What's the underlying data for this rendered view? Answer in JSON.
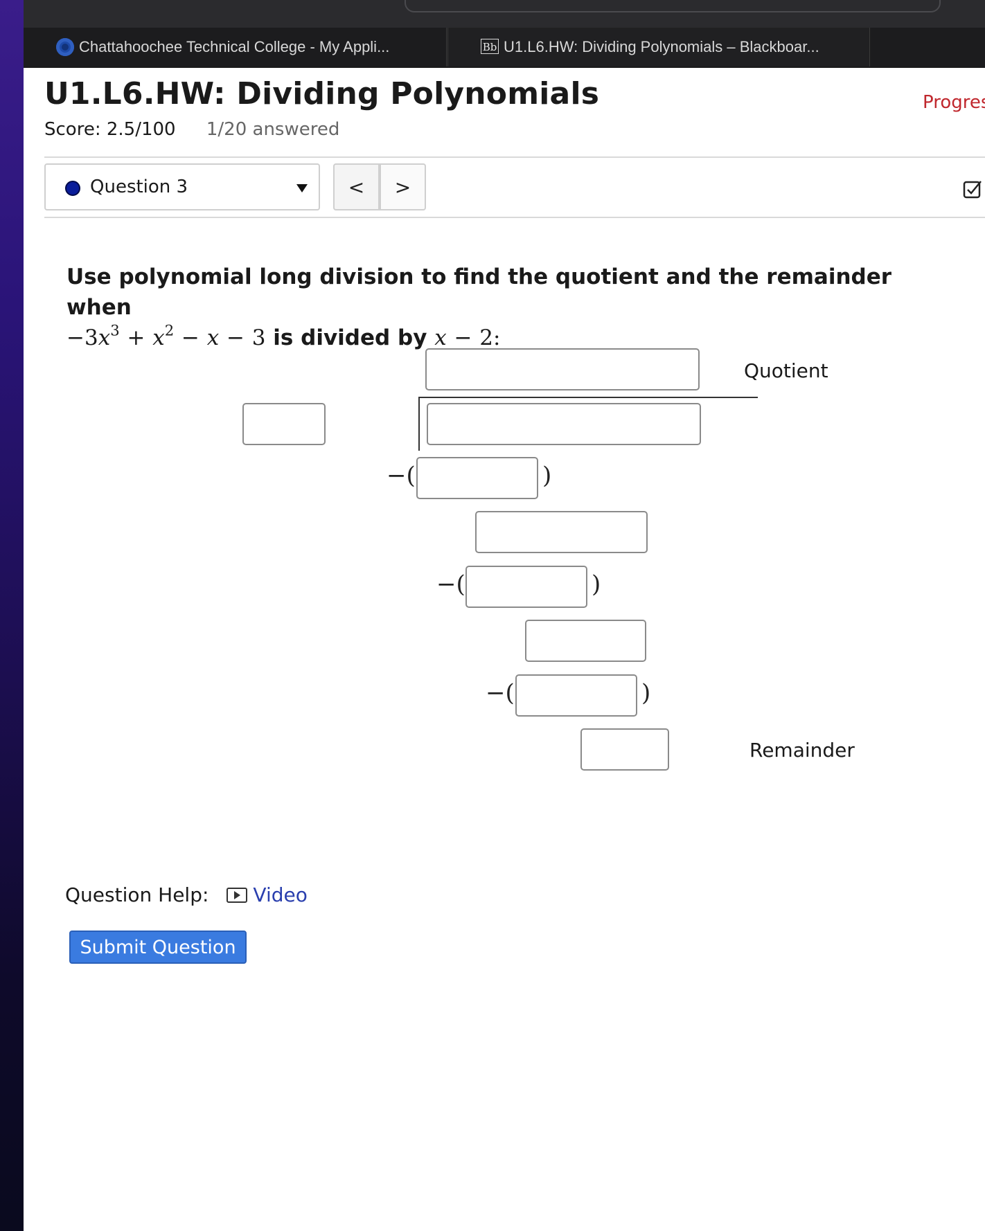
{
  "browser": {
    "tabs": [
      {
        "label": "Chattahoochee Technical College - My Appli..."
      },
      {
        "icon_text": "Bb",
        "label": "U1.L6.HW: Dividing Polynomials – Blackboar..."
      }
    ]
  },
  "header": {
    "title": "U1.L6.HW: Dividing Polynomials",
    "progress_link": "Progres",
    "score": "Score: 2.5/100",
    "answered": "1/20 answered"
  },
  "question_nav": {
    "selected": "Question 3",
    "prev_icon": "<",
    "next_icon": ">"
  },
  "question": {
    "prompt_line1": "Use polynomial long division to find the quotient and the remainder when",
    "expression": {
      "neg": "−",
      "coef": "3",
      "var": "x",
      "exp3": "3",
      "plus": "+",
      "exp2": "2",
      "minus1": "−",
      "minus2": "−",
      "const": "3",
      "is_divided_by": "is divided by",
      "divisor_var": "x",
      "divisor_minus": "−",
      "divisor_const": "2:"
    },
    "quotient_label": "Quotient",
    "remainder_label": "Remainder",
    "subtract_prefix": "−(",
    "subtract_suffix": ")"
  },
  "help": {
    "label": "Question Help:",
    "video_link": "Video"
  },
  "submit_label": "Submit Question",
  "colors": {
    "accent": "#3a7be0",
    "progress": "#c0272d",
    "status_dot": "#0a1d9a",
    "link": "#2a3fae"
  }
}
